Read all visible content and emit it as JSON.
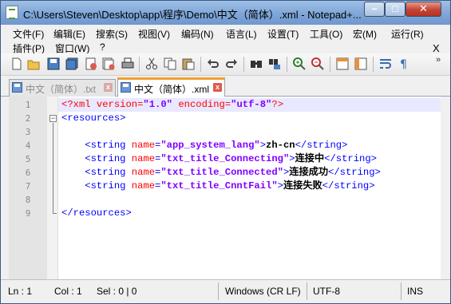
{
  "window": {
    "title": "C:\\Users\\Steven\\Desktop\\app\\程序\\Demo\\中文（简体）.xml - Notepad+...",
    "min_label": "–",
    "max_label": "□",
    "close_label": "✕"
  },
  "menu": {
    "row1": [
      "文件(F)",
      "编辑(E)",
      "搜索(S)",
      "视图(V)",
      "编码(N)",
      "语言(L)",
      "设置(T)",
      "工具(O)",
      "宏(M)",
      "运行(R)"
    ],
    "row2": [
      "插件(P)",
      "窗口(W)",
      "?"
    ],
    "close_doc": "X"
  },
  "toolbar": {
    "icons": [
      "new-file",
      "open-file",
      "save",
      "save-all",
      "close",
      "close-all",
      "print",
      "cut",
      "copy",
      "paste",
      "undo",
      "redo",
      "find",
      "replace",
      "zoom-in",
      "zoom-out",
      "sync-vertical",
      "sync-horizontal",
      "word-wrap",
      "show-all-chars"
    ],
    "more": "»"
  },
  "tabs": [
    {
      "label": "中文（简体）.txt",
      "active": false
    },
    {
      "label": "中文（简体）.xml",
      "active": true
    }
  ],
  "tab_close": "x",
  "editor": {
    "lines": [
      {
        "num": "1",
        "parts": [
          {
            "t": "pi",
            "v": "<?xml "
          },
          {
            "t": "attr",
            "v": "version"
          },
          {
            "t": "pi",
            "v": "="
          },
          {
            "t": "val",
            "v": "\"1.0\""
          },
          {
            "t": "pi",
            "v": " "
          },
          {
            "t": "attr",
            "v": "encoding"
          },
          {
            "t": "pi",
            "v": "="
          },
          {
            "t": "val",
            "v": "\"utf-8\""
          },
          {
            "t": "pi",
            "v": "?>"
          }
        ]
      },
      {
        "num": "2",
        "parts": [
          {
            "t": "tag",
            "v": "<resources>"
          }
        ]
      },
      {
        "num": "3",
        "parts": []
      },
      {
        "num": "4",
        "parts": [
          {
            "t": "tag",
            "v": "    <string "
          },
          {
            "t": "attr",
            "v": "name"
          },
          {
            "t": "brk",
            "v": "="
          },
          {
            "t": "val",
            "v": "\"app_system_lang\""
          },
          {
            "t": "brk",
            "v": ">"
          },
          {
            "t": "text",
            "v": "zh-cn"
          },
          {
            "t": "tag",
            "v": "</string>"
          }
        ]
      },
      {
        "num": "5",
        "parts": [
          {
            "t": "tag",
            "v": "    <string "
          },
          {
            "t": "attr",
            "v": "name"
          },
          {
            "t": "brk",
            "v": "="
          },
          {
            "t": "val",
            "v": "\"txt_title_Connecting\""
          },
          {
            "t": "brk",
            "v": ">"
          },
          {
            "t": "text",
            "v": "连接中"
          },
          {
            "t": "tag",
            "v": "</string>"
          }
        ]
      },
      {
        "num": "6",
        "parts": [
          {
            "t": "tag",
            "v": "    <string "
          },
          {
            "t": "attr",
            "v": "name"
          },
          {
            "t": "brk",
            "v": "="
          },
          {
            "t": "val",
            "v": "\"txt_title_Connected\""
          },
          {
            "t": "brk",
            "v": ">"
          },
          {
            "t": "text",
            "v": "连接成功"
          },
          {
            "t": "tag",
            "v": "</string>"
          }
        ]
      },
      {
        "num": "7",
        "parts": [
          {
            "t": "tag",
            "v": "    <string "
          },
          {
            "t": "attr",
            "v": "name"
          },
          {
            "t": "brk",
            "v": "="
          },
          {
            "t": "val",
            "v": "\"txt_title_CnntFail\""
          },
          {
            "t": "brk",
            "v": ">"
          },
          {
            "t": "text",
            "v": "连接失败"
          },
          {
            "t": "tag",
            "v": "</string>"
          }
        ]
      },
      {
        "num": "8",
        "parts": []
      },
      {
        "num": "9",
        "parts": [
          {
            "t": "tag",
            "v": "</resources>"
          }
        ]
      }
    ]
  },
  "status": {
    "ln": "Ln : 1",
    "col": "Col : 1",
    "sel": "Sel : 0 | 0",
    "eol": "Windows (CR LF)",
    "enc": "UTF-8",
    "mode": "INS"
  },
  "colors": {
    "pi": "#ff0000",
    "tag": "#0000ff",
    "attr": "#ff0000",
    "value": "#8000ff",
    "current_line": "#e8e8ff",
    "active_tab_accent": "#f0a030"
  }
}
